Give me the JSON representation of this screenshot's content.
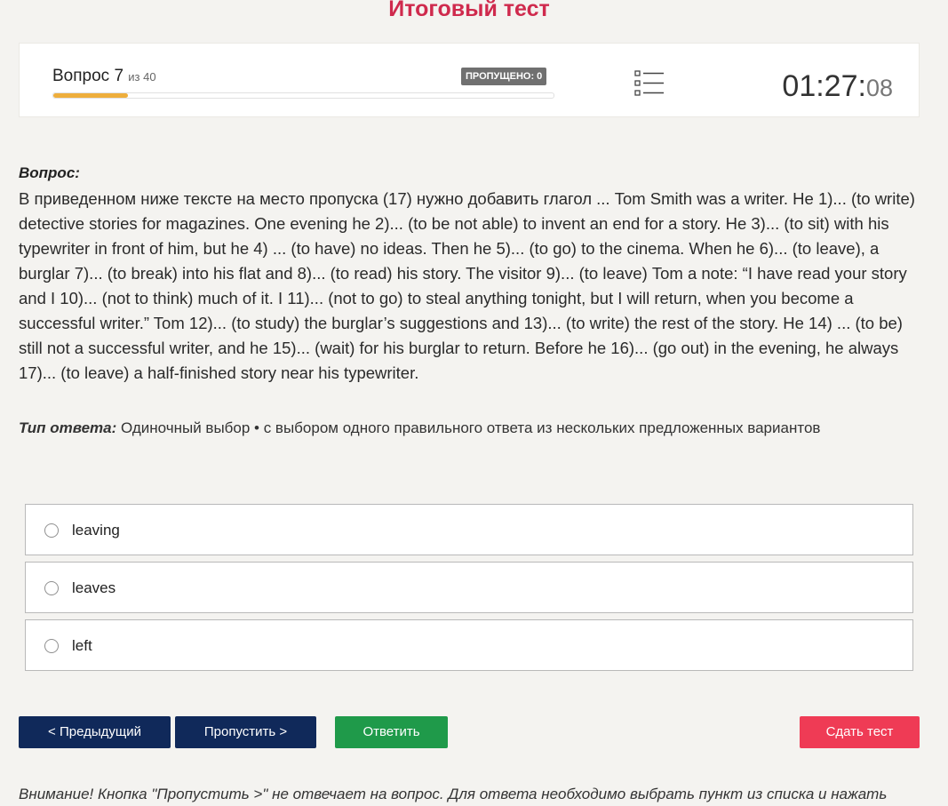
{
  "header": {
    "title": "Итоговый тест"
  },
  "status": {
    "question_label": "Вопрос 7",
    "question_total": "из 40",
    "skipped_badge": "ПРОПУЩЕНО: 0",
    "progress_fraction": 0.15,
    "progress_color": "#eeae3c",
    "list_icon": "list-icon",
    "timer_main": "01:27:",
    "timer_seconds": "08"
  },
  "question": {
    "label": "Вопрос:",
    "text": "В приведенном ниже тексте на место пропуска (17) нужно добавить глагол ... Tom Smith was a writer. He 1)... (to write) detective stories for magazines. One evening he 2)... (to be not able) to invent an end for a story. He 3)... (to sit) with his typewriter in front of him, but he 4) ... (to have) no ideas. Then he 5)... (to go) to the cinema. When he 6)... (to leave), a burglar 7)... (to break) into his flat and 8)... (to read) his story. The visitor 9)... (to leave) Tom a note: “I have read your story and I 10)... (not to think) much of it. I 11)... (not to go) to steal anything tonight, but I will return, when you become a successful writer.” Tom 12)... (to study) the burglar’s suggestions and 13)... (to write) the rest of the story. He 14) ... (to be) still not a successful writer, and he 15)... (wait) for his burglar to return. Before he 16)... (go out) in the evening, he always 17)... (to leave) a half-finished story near his typewriter.",
    "answer_type_label": "Тип ответа:",
    "answer_type_value": "Одиночный выбор • с выбором одного правильного ответа из нескольких предложенных вариантов"
  },
  "options": [
    {
      "label": "leaving"
    },
    {
      "label": "leaves"
    },
    {
      "label": "left"
    }
  ],
  "buttons": {
    "prev": "< Предыдущий",
    "skip": "Пропустить >",
    "answer": "Ответить",
    "submit": "Сдать тест"
  },
  "colors": {
    "title": "#cf2a4d",
    "nav_button": "#10295a",
    "answer_button": "#1f9a4a",
    "submit_button": "#ef3b55"
  },
  "footer": {
    "notice": "Внимание! Кнопка \"Пропустить >\" не отвечает на вопрос. Для ответа необходимо выбрать пункт из списка и нажать"
  }
}
